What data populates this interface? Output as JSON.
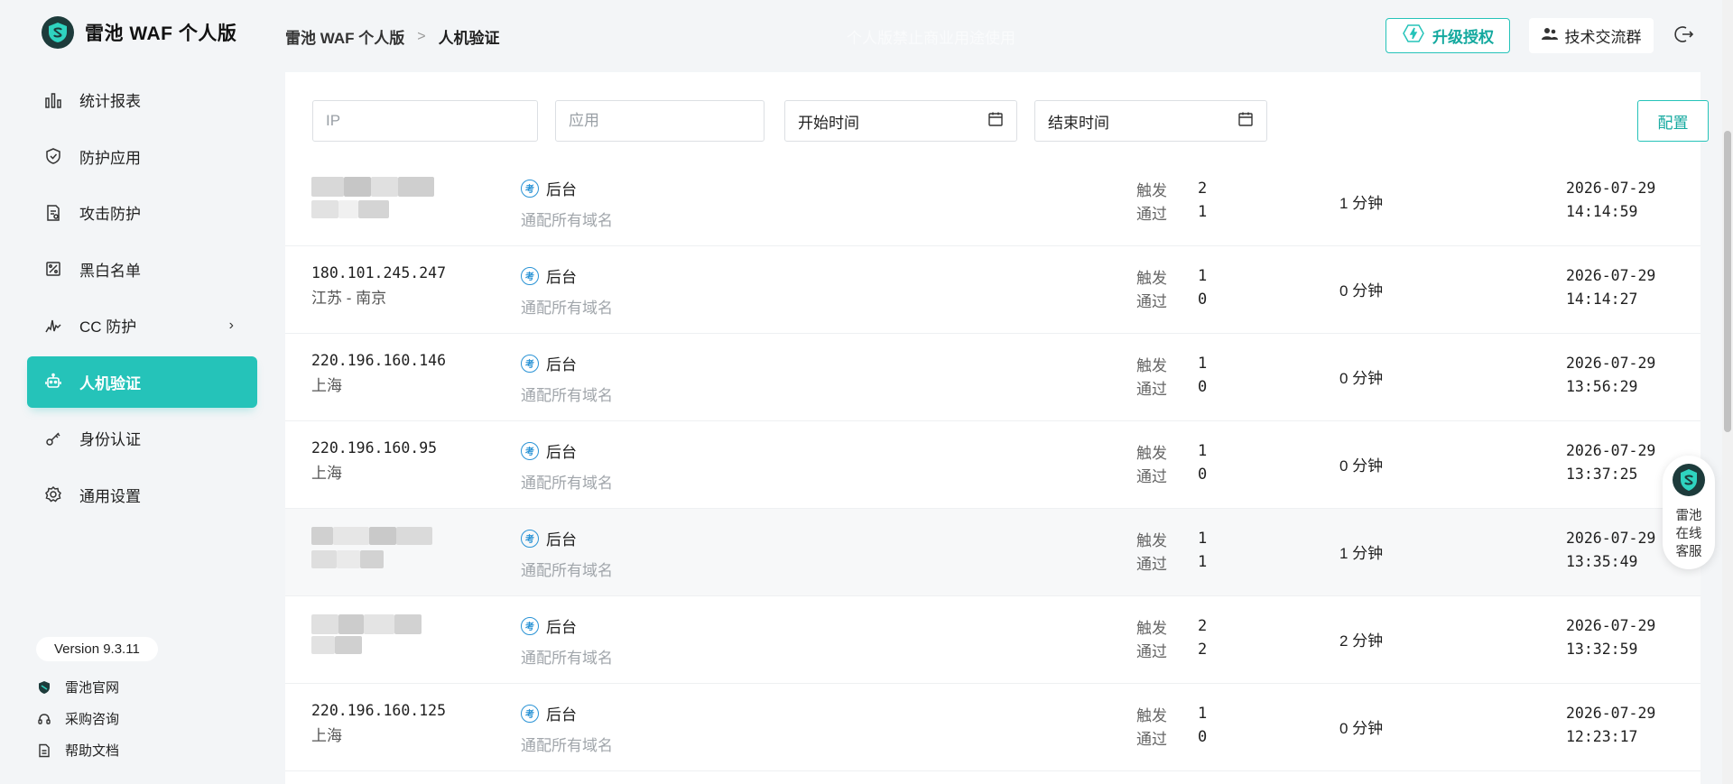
{
  "app": {
    "logo_text": "雷池 WAF 个人版"
  },
  "header": {
    "breadcrumb_root": "雷池 WAF 个人版",
    "breadcrumb_current": "人机验证",
    "watermark": "个人版禁止商业用途使用",
    "upgrade_label": "升级授权",
    "group_label": "技术交流群"
  },
  "sidebar": {
    "items": [
      {
        "label": "统计报表",
        "icon": "bar-chart-icon"
      },
      {
        "label": "防护应用",
        "icon": "shield-icon"
      },
      {
        "label": "攻击防护",
        "icon": "document-scan-icon"
      },
      {
        "label": "黑白名单",
        "icon": "percent-list-icon"
      },
      {
        "label": "CC 防护",
        "icon": "pulse-icon"
      },
      {
        "label": "人机验证",
        "icon": "robot-icon"
      },
      {
        "label": "身份认证",
        "icon": "key-icon"
      },
      {
        "label": "通用设置",
        "icon": "gear-icon"
      }
    ],
    "version": "Version 9.3.11",
    "links": [
      {
        "label": "雷池官网",
        "icon": "logo-icon"
      },
      {
        "label": "采购咨询",
        "icon": "headset-icon"
      },
      {
        "label": "帮助文档",
        "icon": "doc-icon"
      }
    ]
  },
  "filters": {
    "ip_placeholder": "IP",
    "app_placeholder": "应用",
    "start_label": "开始时间",
    "end_label": "结束时间",
    "config_label": "配置"
  },
  "table": {
    "trigger_label": "触发",
    "pass_label": "通过",
    "rows": [
      {
        "ip": "",
        "location": "",
        "app": "后台",
        "domain": "通配所有域名",
        "trigger": "2",
        "pass": "1",
        "duration": "1 分钟",
        "date": "2026-07-29",
        "time": "14:14:59"
      },
      {
        "ip": "180.101.245.247",
        "location": "江苏 - 南京",
        "app": "后台",
        "domain": "通配所有域名",
        "trigger": "1",
        "pass": "0",
        "duration": "0 分钟",
        "date": "2026-07-29",
        "time": "14:14:27"
      },
      {
        "ip": "220.196.160.146",
        "location": "上海",
        "app": "后台",
        "domain": "通配所有域名",
        "trigger": "1",
        "pass": "0",
        "duration": "0 分钟",
        "date": "2026-07-29",
        "time": "13:56:29"
      },
      {
        "ip": "220.196.160.95",
        "location": "上海",
        "app": "后台",
        "domain": "通配所有域名",
        "trigger": "1",
        "pass": "0",
        "duration": "0 分钟",
        "date": "2026-07-29",
        "time": "13:37:25"
      },
      {
        "ip": "",
        "location": "",
        "app": "后台",
        "domain": "通配所有域名",
        "trigger": "1",
        "pass": "1",
        "duration": "1 分钟",
        "date": "2026-07-29",
        "time": "13:35:49"
      },
      {
        "ip": "",
        "location": "",
        "app": "后台",
        "domain": "通配所有域名",
        "trigger": "2",
        "pass": "2",
        "duration": "2 分钟",
        "date": "2026-07-29",
        "time": "13:32:59"
      },
      {
        "ip": "220.196.160.125",
        "location": "上海",
        "app": "后台",
        "domain": "通配所有域名",
        "trigger": "1",
        "pass": "0",
        "duration": "0 分钟",
        "date": "2026-07-29",
        "time": "12:23:17"
      }
    ]
  },
  "float_service": {
    "line1": "雷池",
    "line2": "在线",
    "line3": "客服"
  },
  "colors": {
    "accent": "#25c3b9",
    "accent_text": "#14a99f",
    "app_icon": "#2a93d5"
  }
}
